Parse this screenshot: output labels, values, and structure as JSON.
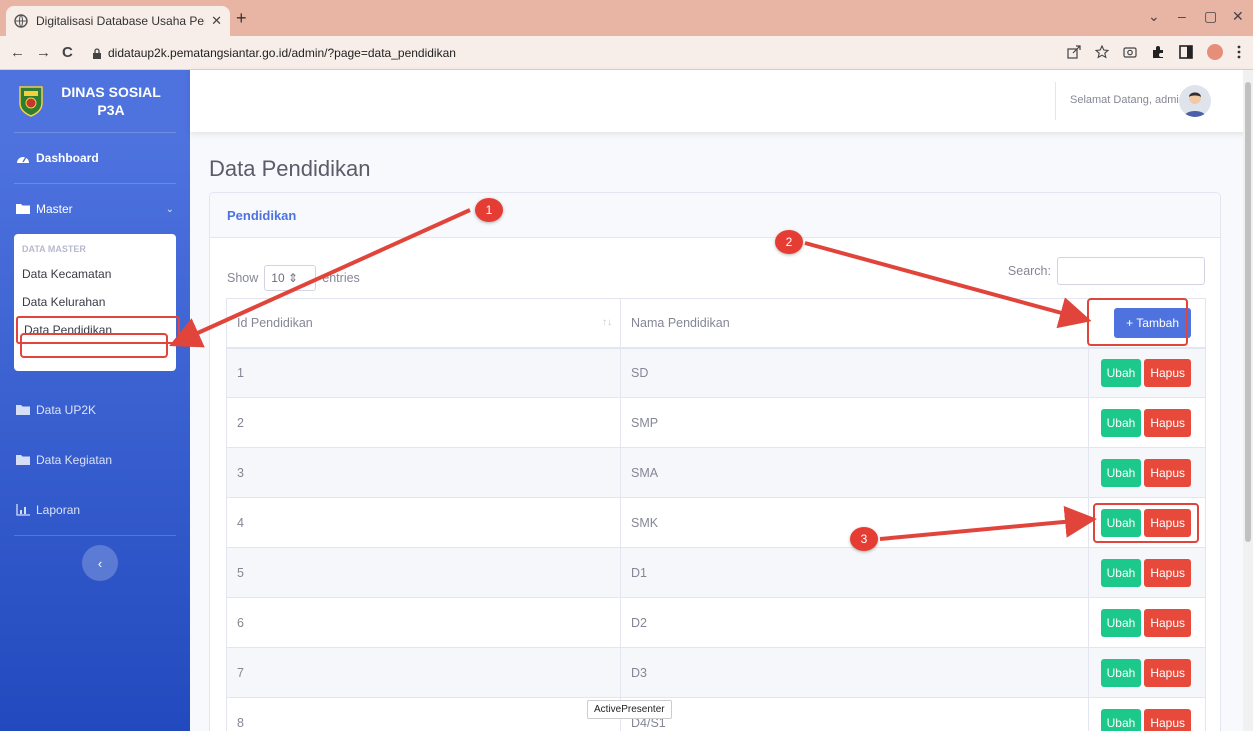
{
  "browser": {
    "tab_title": "Digitalisasi Database Usaha Peni:",
    "url": "didataup2k.pematangsiantar.go.id/admin/?page=data_pendidikan",
    "new_tab": "+",
    "close": "✕",
    "back": "←",
    "forward": "→",
    "reload": "C",
    "win_min": "–",
    "win_max": "▢",
    "win_close": "✕",
    "win_menu": "⌄"
  },
  "sidebar": {
    "brand_line1": "DINAS SOSIAL",
    "brand_line2": "P3A",
    "dashboard": "Dashboard",
    "master": "Master",
    "collapse_header": "DATA MASTER",
    "collapse_items": [
      "Data Kecamatan",
      "Data Kelurahan",
      "Data Pendidikan"
    ],
    "data_up2k": "Data UP2K",
    "data_kegiatan": "Data Kegiatan",
    "laporan": "Laporan",
    "toggle": "‹"
  },
  "topbar": {
    "welcome": "Selamat Datang, admin"
  },
  "page": {
    "title": "Data Pendidikan",
    "card_title": "Pendidikan",
    "show_label": "Show",
    "entries_value": "10",
    "entries_label": "entries",
    "search_label": "Search:"
  },
  "table": {
    "headers": [
      "Id Pendidikan",
      "Nama Pendidikan"
    ],
    "tambah_label": "+ Tambah",
    "ubah_label": "Ubah",
    "hapus_label": "Hapus",
    "rows": [
      [
        "1",
        "SD"
      ],
      [
        "2",
        "SMP"
      ],
      [
        "3",
        "SMA"
      ],
      [
        "4",
        "SMK"
      ],
      [
        "5",
        "D1"
      ],
      [
        "6",
        "D2"
      ],
      [
        "7",
        "D3"
      ],
      [
        "8",
        "D4/S1"
      ]
    ]
  },
  "annotations": {
    "badges": [
      "1",
      "2",
      "3"
    ]
  },
  "tooltip": "ActivePresenter",
  "colors": {
    "primary": "#4e73df",
    "success": "#1cc88a",
    "danger": "#e74a3b",
    "annotation": "#e0443a"
  }
}
